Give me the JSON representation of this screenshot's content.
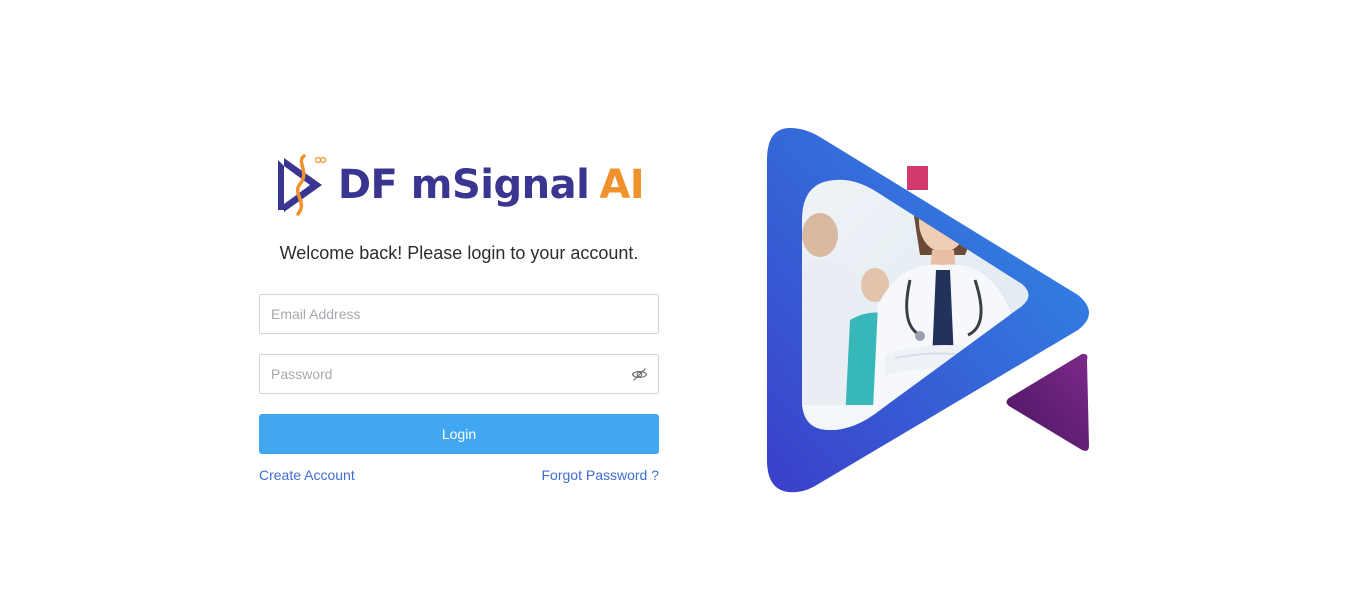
{
  "brand": {
    "name_main": "DF mSignal",
    "name_accent": "AI"
  },
  "welcome_text": "Welcome back! Please login to your account.",
  "email": {
    "placeholder": "Email Address",
    "value": ""
  },
  "password": {
    "placeholder": "Password",
    "value": ""
  },
  "login_label": "Login",
  "links": {
    "create_account": "Create Account",
    "forgot_password": "Forgot Password ?"
  },
  "icons": {
    "password_toggle": "eye-off-icon",
    "logo": "df-logo-icon"
  },
  "colors": {
    "brand_navy": "#3a3591",
    "brand_orange": "#f0922b",
    "login_button": "#42a7f2",
    "link": "#3f6ed1",
    "hero_blue_start": "#3b3fc9",
    "hero_blue_end": "#2f8fe8",
    "hero_purple": "#6a1f7a",
    "hero_pink": "#d23a6e"
  }
}
